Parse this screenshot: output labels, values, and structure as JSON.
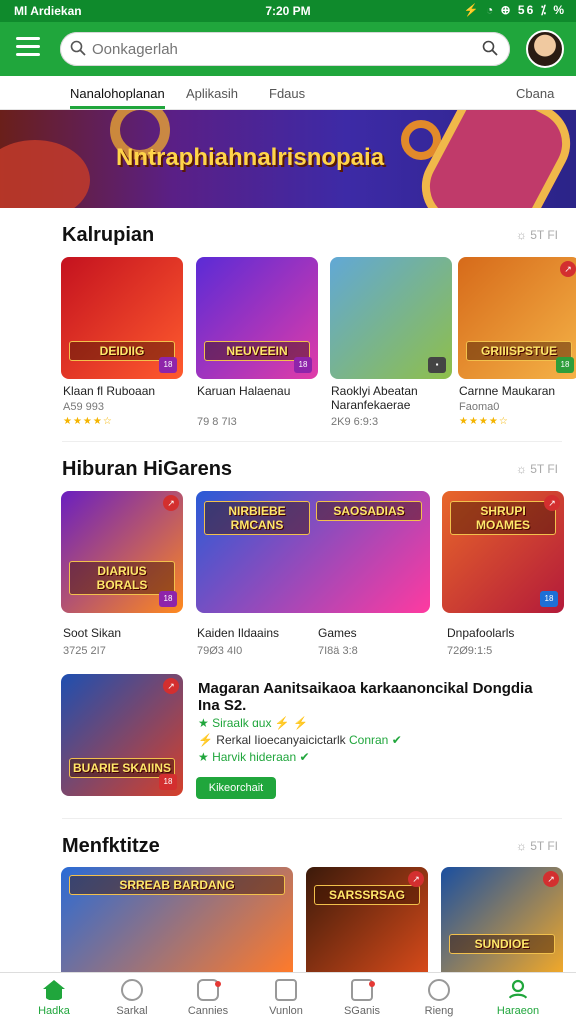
{
  "status": {
    "left": "Ml Ardiekan",
    "time": "7:20 PM",
    "right": "⚡ ◔ ⊕ 56 ⁒ %"
  },
  "search": {
    "placeholder": "Oonkagerlah"
  },
  "tabs": [
    "Nanalohoplanan",
    "Aplikasih",
    "Fdaus",
    "Cbana"
  ],
  "banner": {
    "title": "Nntraphiahnalrisnopaia"
  },
  "sections": [
    {
      "title": "Kalrupian",
      "more": "☼ 5T FI",
      "items": [
        {
          "label": "DEIDIIG",
          "name": "Klaan fl Ruboaan",
          "meta": "A59 993",
          "rating": "★★★★☆",
          "colors": [
            "#c4121f",
            "#ff5b2e"
          ]
        },
        {
          "label": "NEUVEEIN",
          "name": "Karuan Halaenau",
          "meta": "79 8 7I3",
          "colors": [
            "#5b2bd6",
            "#e03ca8"
          ]
        },
        {
          "label": "",
          "name": "Raoklyi Abeatan Naranfekaerae",
          "meta": "2K9 6:9:3",
          "colors": [
            "#61a8d6",
            "#8fbf4a"
          ]
        },
        {
          "label": "GRIIISPSTUE",
          "name": "Carnne Maukaran",
          "meta": "Faoma0",
          "rating": "★★★★☆",
          "colors": [
            "#d66a1a",
            "#f5b347"
          ]
        }
      ]
    },
    {
      "title": "Hiburan HiGarens",
      "more": "☼ 5T FI",
      "items": [
        {
          "label": "DIARIUS BORALS",
          "name": "Soot Sikan",
          "meta": "3725 2I7",
          "colors": [
            "#6a1fc0",
            "#ff8a1e"
          ]
        },
        {
          "label": "NIRBIEBE RMCANS",
          "name": "Kaiden Ildaains",
          "meta": "79Ø3 4I0",
          "colors": [
            "#2a5bd6",
            "#ff3aa0"
          ]
        },
        {
          "label": "SAOSADIAS",
          "name": "Games",
          "meta": "7I8ä 3:8",
          "colors": [
            "#ff4fa0",
            "#4a2fb8"
          ]
        },
        {
          "label": "SHRUPI MOAMES",
          "name": "Dnpafoolarls",
          "meta": "72Ø9:1:5",
          "colors": [
            "#e8672a",
            "#b31a3a"
          ]
        }
      ]
    },
    {
      "title": "Menfktitze",
      "more": "☼ 5T FI",
      "items": [
        {
          "label": "SRREAB BARDANG",
          "colors": [
            "#2a6bd6",
            "#ff7a2a"
          ]
        },
        {
          "label": "SARSSRSAG",
          "colors": [
            "#3b1a0a",
            "#d64a1a"
          ]
        },
        {
          "label": "SUNDIOE",
          "colors": [
            "#1a4fa0",
            "#f0a82a"
          ]
        }
      ]
    }
  ],
  "featured": {
    "title": "Magaran Aanitsaikaoa karkaanoncikal Dongdia Ina S2.",
    "line1": "★ Siraalk ɑux ⚡ ⚡",
    "line2a": "⚡ Rerkal Iioecanyaicictarlk",
    "line2b": "Conran ✔",
    "line3": "★ Harvik hideraan ✔",
    "button": "Kikeorchait",
    "card_label": "BUARIE SKAIINS"
  },
  "bottom_nav": [
    {
      "label": "Hadka",
      "icon": "home-icon"
    },
    {
      "label": "Sarkal",
      "icon": "compass-icon"
    },
    {
      "label": "Cannies",
      "icon": "games-icon"
    },
    {
      "label": "Vunlon",
      "icon": "apps-icon"
    },
    {
      "label": "SGanis",
      "icon": "updates-icon"
    },
    {
      "label": "Rieng",
      "icon": "notifications-icon"
    },
    {
      "label": "Haraeon",
      "icon": "profile-icon"
    }
  ],
  "theme": {
    "accent": "#20a63c",
    "status_bar": "#0f8a2c"
  }
}
